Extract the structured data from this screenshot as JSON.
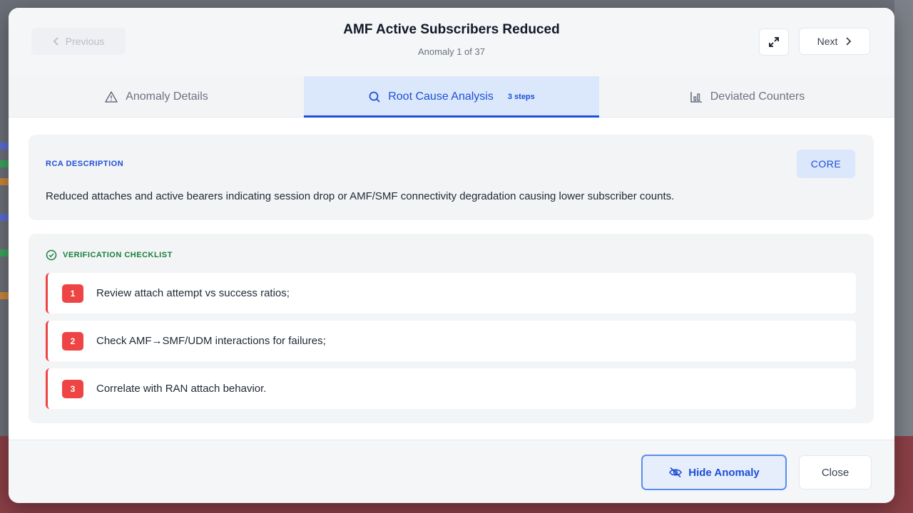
{
  "header": {
    "previous_label": "Previous",
    "title": "AMF Active Subscribers Reduced",
    "subtitle": "Anomaly 1 of 37",
    "next_label": "Next"
  },
  "tabs": [
    {
      "label": "Anomaly Details",
      "icon": "warning-icon",
      "active": false
    },
    {
      "label": "Root Cause Analysis",
      "icon": "search-icon",
      "active": true,
      "badge": "3 steps"
    },
    {
      "label": "Deviated Counters",
      "icon": "chart-icon",
      "active": false
    }
  ],
  "rca": {
    "label": "RCA DESCRIPTION",
    "badge": "CORE",
    "text": "Reduced attaches and active bearers indicating session drop or AMF/SMF connectivity degradation causing lower subscriber counts."
  },
  "checklist": {
    "label": "VERIFICATION CHECKLIST",
    "items": [
      {
        "number": "1",
        "text": "Review attach attempt vs success ratios;"
      },
      {
        "number": "2",
        "text": "Check AMF→SMF/UDM interactions for failures;"
      },
      {
        "number": "3",
        "text": "Correlate with RAN attach behavior."
      }
    ]
  },
  "footer": {
    "hide_label": "Hide Anomaly",
    "close_label": "Close"
  },
  "colors": {
    "accent": "#1d4ed8",
    "checklist_accent": "#15803d",
    "step_badge": "#ef4444"
  }
}
